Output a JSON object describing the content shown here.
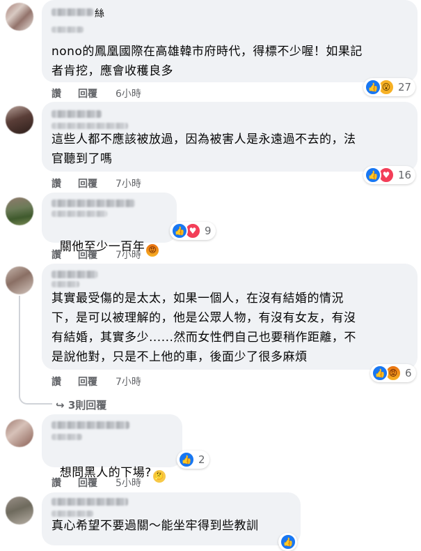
{
  "comments": [
    {
      "name_suffix": "絲",
      "text": "nono的鳳凰國際在高雄韓市府時代，得標不少喔！如果記者肯挖，應會收穫良多",
      "line1": "nono的鳳凰國際在高雄韓市府時代，得標不少喔！如果記",
      "line2": "者肯挖，應會收穫良多",
      "like": "讚",
      "reply": "回覆",
      "time": "6小時",
      "reactions": [
        "like-icon",
        "wow-icon"
      ],
      "count": "27"
    },
    {
      "line1": "這些人都不應該被放過，因為被害人是永遠過不去的，法",
      "line2": "官聽到了嗎",
      "like": "讚",
      "reply": "回覆",
      "time": "7小時",
      "reactions": [
        "like-icon",
        "love-icon"
      ],
      "count": "16"
    },
    {
      "line1": "關他至少一百年",
      "like": "讚",
      "reply": "回覆",
      "time": "7小時",
      "reactions": [
        "like-icon",
        "love-icon"
      ],
      "count": "9"
    },
    {
      "line1": "其實最受傷的是太太，如果一個人，在沒有結婚的情況",
      "line2": "下，是可以被理解的，他是公眾人物，有沒有女友，有沒",
      "line3": "有結婚，其實多少......然而女性們自己也要稍作距離，不",
      "line4": "是說他對，只是不上他的車，後面少了很多麻煩",
      "like": "讚",
      "reply": "回覆",
      "time": "7小時",
      "reactions": [
        "like-icon",
        "angry-icon"
      ],
      "count": "6",
      "replies_link": "3則回覆"
    },
    {
      "line1": "想問黑人的下場?",
      "like": "讚",
      "reply": "回覆",
      "time": "5小時",
      "reactions": [
        "like-icon"
      ],
      "count": "2"
    },
    {
      "line1": "真心希望不要過關～能坐牢得到些教訓",
      "reactions": [
        "like-icon"
      ]
    }
  ],
  "colors": {
    "bubble": "#f0f2f5",
    "like": "#1877f2",
    "meta": "#65676b"
  }
}
